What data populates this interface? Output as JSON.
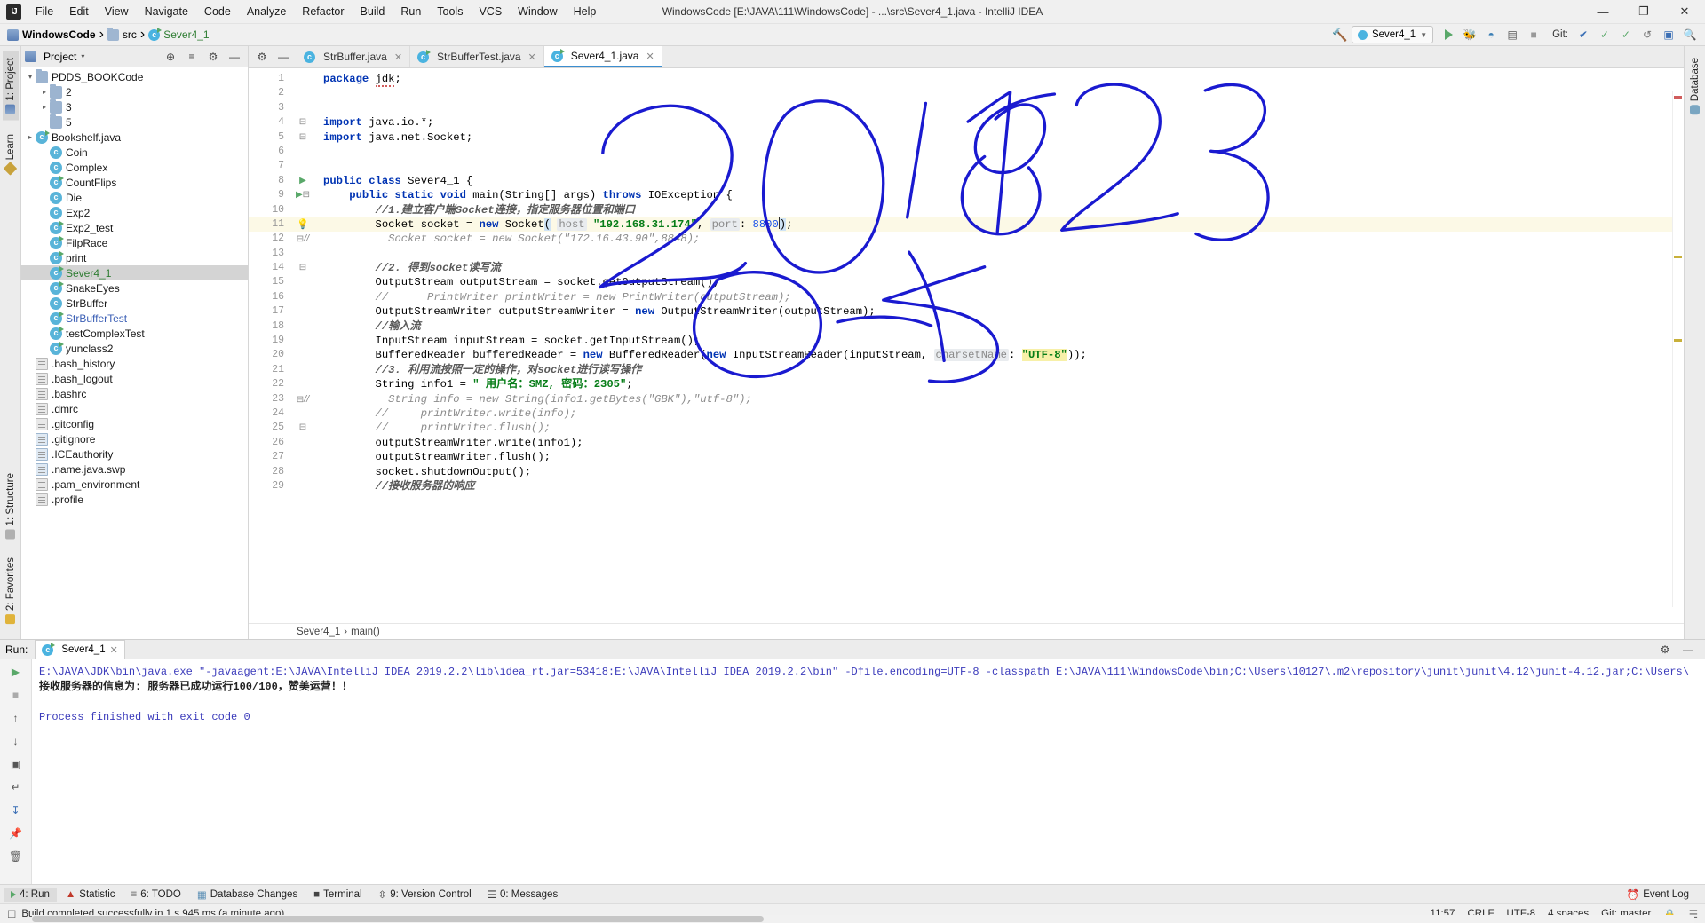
{
  "window": {
    "title": "WindowsCode [E:\\JAVA\\111\\WindowsCode] - ...\\src\\Sever4_1.java - IntelliJ IDEA",
    "logo": "IJ",
    "minimize": "—",
    "maximize": "❐",
    "close": "✕"
  },
  "menubar": {
    "items": [
      {
        "label": "File"
      },
      {
        "label": "Edit"
      },
      {
        "label": "View"
      },
      {
        "label": "Navigate"
      },
      {
        "label": "Code"
      },
      {
        "label": "Analyze"
      },
      {
        "label": "Refactor"
      },
      {
        "label": "Build"
      },
      {
        "label": "Run"
      },
      {
        "label": "Tools"
      },
      {
        "label": "VCS"
      },
      {
        "label": "Window"
      },
      {
        "label": "Help"
      }
    ]
  },
  "navbar": {
    "crumbs": [
      {
        "label": "WindowsCode",
        "icon": "project-icon"
      },
      {
        "label": "src",
        "icon": "folder-icon"
      },
      {
        "label": "Sever4_1",
        "icon": "java-class-icon"
      }
    ],
    "separator": "›",
    "run_config": "Sever4_1",
    "git_label": "Git:",
    "actions": {
      "hammer": "⚒",
      "run": "run-icon",
      "debug": "ὁE",
      "coverage": "◑",
      "profile": "▤",
      "stop": "■",
      "update": "✔",
      "commit": "✓",
      "push": "↑",
      "rollback": "↺",
      "layout": "▣",
      "search": "ὐD"
    }
  },
  "left_strip": {
    "tabs": [
      {
        "label": "1: Project",
        "icon": "project-icon",
        "active": true
      },
      {
        "label": "Learn",
        "icon": "learn-icon",
        "active": false
      }
    ],
    "bottom_tabs": [
      {
        "label": "1: Structure",
        "icon": "structure-icon"
      },
      {
        "label": "2: Favorites",
        "icon": "favorites-icon"
      }
    ]
  },
  "right_strip": {
    "tabs": [
      {
        "label": "Database",
        "icon": "database-icon"
      }
    ]
  },
  "project_panel": {
    "title": "Project",
    "caret": "▾",
    "actions": [
      {
        "name": "locate-icon",
        "glyph": "⊕"
      },
      {
        "name": "collapse-all-icon",
        "glyph": "≡"
      },
      {
        "name": "settings-icon",
        "glyph": "⚙"
      },
      {
        "name": "hide-icon",
        "glyph": "—"
      }
    ],
    "tree": [
      {
        "label": "PDDS_BOOKCode",
        "icon": "folder-icon",
        "arrow": "∨",
        "indent": 1,
        "color": "normal"
      },
      {
        "label": "2",
        "icon": "folder-icon",
        "arrow": "›",
        "indent": 2,
        "color": "normal"
      },
      {
        "label": "3",
        "icon": "folder-icon",
        "arrow": "›",
        "indent": 2,
        "color": "normal"
      },
      {
        "label": "5",
        "icon": "folder-icon",
        "arrow": "",
        "indent": 2,
        "color": "normal"
      },
      {
        "label": "Bookshelf.java",
        "icon": "java-class-run-icon",
        "arrow": "›",
        "indent": 1,
        "color": "normal"
      },
      {
        "label": "Coin",
        "icon": "java-class-icon",
        "arrow": "",
        "indent": 2,
        "color": "normal"
      },
      {
        "label": "Complex",
        "icon": "java-class-icon",
        "arrow": "",
        "indent": 2,
        "color": "normal"
      },
      {
        "label": "CountFlips",
        "icon": "java-class-run-icon",
        "arrow": "",
        "indent": 2,
        "color": "normal"
      },
      {
        "label": "Die",
        "icon": "java-class-icon",
        "arrow": "",
        "indent": 2,
        "color": "normal"
      },
      {
        "label": "Exp2",
        "icon": "java-class-icon",
        "arrow": "",
        "indent": 2,
        "color": "normal"
      },
      {
        "label": "Exp2_test",
        "icon": "java-class-run-icon",
        "arrow": "",
        "indent": 2,
        "color": "normal"
      },
      {
        "label": "FilpRace",
        "icon": "java-class-run-icon",
        "arrow": "",
        "indent": 2,
        "color": "normal"
      },
      {
        "label": "print",
        "icon": "java-class-run-icon",
        "arrow": "",
        "indent": 2,
        "color": "normal"
      },
      {
        "label": "Sever4_1",
        "icon": "java-class-run-icon",
        "arrow": "",
        "indent": 2,
        "color": "green",
        "selected": true
      },
      {
        "label": "SnakeEyes",
        "icon": "java-class-run-icon",
        "arrow": "",
        "indent": 2,
        "color": "normal"
      },
      {
        "label": "StrBuffer",
        "icon": "java-class-icon",
        "arrow": "",
        "indent": 2,
        "color": "normal"
      },
      {
        "label": "StrBufferTest",
        "icon": "java-class-run-icon",
        "arrow": "",
        "indent": 2,
        "color": "blue"
      },
      {
        "label": "testComplexTest",
        "icon": "java-class-run-icon",
        "arrow": "",
        "indent": 2,
        "color": "normal"
      },
      {
        "label": "yunclass2",
        "icon": "java-class-run-icon",
        "arrow": "",
        "indent": 2,
        "color": "normal"
      },
      {
        "label": ".bash_history",
        "icon": "file-icon",
        "arrow": "",
        "indent": 1,
        "color": "normal"
      },
      {
        "label": ".bash_logout",
        "icon": "file-icon",
        "arrow": "",
        "indent": 1,
        "color": "normal"
      },
      {
        "label": ".bashrc",
        "icon": "file-icon",
        "arrow": "",
        "indent": 1,
        "color": "normal"
      },
      {
        "label": ".dmrc",
        "icon": "file-icon",
        "arrow": "",
        "indent": 1,
        "color": "normal"
      },
      {
        "label": ".gitconfig",
        "icon": "file-icon",
        "arrow": "",
        "indent": 1,
        "color": "normal"
      },
      {
        "label": ".gitignore",
        "icon": "config-file-icon",
        "arrow": "",
        "indent": 1,
        "color": "normal"
      },
      {
        "label": ".ICEauthority",
        "icon": "config-file-icon",
        "arrow": "",
        "indent": 1,
        "color": "normal"
      },
      {
        "label": ".name.java.swp",
        "icon": "config-file-icon",
        "arrow": "",
        "indent": 1,
        "color": "normal"
      },
      {
        "label": ".pam_environment",
        "icon": "file-icon",
        "arrow": "",
        "indent": 1,
        "color": "normal"
      },
      {
        "label": ".profile",
        "icon": "file-icon",
        "arrow": "",
        "indent": 1,
        "color": "normal"
      }
    ]
  },
  "editor": {
    "tabs": [
      {
        "label": "StrBuffer.java",
        "icon": "java-class-icon",
        "active": false,
        "close": "✕"
      },
      {
        "label": "StrBufferTest.java",
        "icon": "java-class-run-icon",
        "active": false,
        "close": "✕"
      },
      {
        "label": "Sever4_1.java",
        "icon": "java-class-run-icon",
        "active": true,
        "close": "✕"
      }
    ],
    "tab_actions": [
      {
        "name": "settings-icon",
        "glyph": "⚙"
      },
      {
        "name": "hide-icon",
        "glyph": "—"
      }
    ],
    "breadcrumbs": [
      "Sever4_1",
      "main()"
    ],
    "breadcrumb_sep": "›",
    "first_line": 1,
    "lines": [
      {
        "n": 1,
        "marker": "",
        "html": "<span class=\"kw\">package</span> <span class=\"squig\">jdk</span>;"
      },
      {
        "n": 2,
        "marker": "",
        "html": ""
      },
      {
        "n": 3,
        "marker": "",
        "html": ""
      },
      {
        "n": 4,
        "marker": "fold",
        "html": "<span class=\"kw\">import</span> java.io.*;"
      },
      {
        "n": 5,
        "marker": "fold",
        "html": "<span class=\"kw\">import</span> java.net.Socket;"
      },
      {
        "n": 6,
        "marker": "",
        "html": ""
      },
      {
        "n": 7,
        "marker": "",
        "html": ""
      },
      {
        "n": 8,
        "marker": "run",
        "html": "<span class=\"kw\">public class</span> Sever4_1 {"
      },
      {
        "n": 9,
        "marker": "run-fold",
        "html": "    <span class=\"kw\">public static void</span> main(String[] args) <span class=\"kw\">throws</span> IOException {"
      },
      {
        "n": 10,
        "marker": "",
        "html": "        <span class=\"cmt-b\">//1.建立客户端Socket连接，指定服务器位置和端口</span>"
      },
      {
        "n": 11,
        "marker": "bulb",
        "highlight": true,
        "html": "        Socket socket = <span class=\"kw\">new</span> Socket<span class=\"sel-paren\">(</span> <span class=\"hint\">host</span> <span class=\"str\">\"192.168.31.174\"</span>, <span class=\"hint\">port</span>: <span class=\"num\">8800</span><span class=\"caret-i\"></span><span class=\"sel-paren\">)</span>;"
      },
      {
        "n": 12,
        "marker": "fold-cmt",
        "html": "          <span class=\"cmt\">Socket socket = new Socket(\"172.16.43.90\",8848);</span>"
      },
      {
        "n": 13,
        "marker": "",
        "html": ""
      },
      {
        "n": 14,
        "marker": "fold",
        "html": "        <span class=\"cmt-b\">//2. 得到socket读写流</span>"
      },
      {
        "n": 15,
        "marker": "",
        "html": "        OutputStream outputStream = socket.getOutputStream();"
      },
      {
        "n": 16,
        "marker": "",
        "html": "        <span class=\"cmt\">//      PrintWriter printWriter = new PrintWriter(outputStream);</span>"
      },
      {
        "n": 17,
        "marker": "",
        "html": "        OutputStreamWriter outputStreamWriter = <span class=\"kw\">new</span> OutputStreamWriter(outputStream);"
      },
      {
        "n": 18,
        "marker": "",
        "html": "        <span class=\"cmt-b\">//输入流</span>"
      },
      {
        "n": 19,
        "marker": "",
        "html": "        InputStream inputStream = socket.getInputStream();"
      },
      {
        "n": 20,
        "marker": "",
        "html": "        BufferedReader bufferedReader = <span class=\"kw\">new</span> BufferedReader(<span class=\"kw\">new</span> InputStreamReader(inputStream, <span class=\"hint\">charsetName</span>: <span class=\"str hl-utf\">\"UTF-8\"</span>));"
      },
      {
        "n": 21,
        "marker": "",
        "html": "        <span class=\"cmt-b\">//3. 利用流按照一定的操作，对socket进行读写操作</span>"
      },
      {
        "n": 22,
        "marker": "",
        "html": "        String info1 = <span class=\"str\">\" 用户名：SMZ, 密码：2305\"</span>;"
      },
      {
        "n": 23,
        "marker": "fold-cmt",
        "html": "          <span class=\"cmt\">String info = new String(info1.getBytes(\"GBK\"),\"utf-8\");</span>"
      },
      {
        "n": 24,
        "marker": "",
        "html": "        <span class=\"cmt\">//     printWriter.write(info);</span>"
      },
      {
        "n": 25,
        "marker": "fold",
        "html": "        <span class=\"cmt\">//     printWriter.flush();</span>"
      },
      {
        "n": 26,
        "marker": "",
        "html": "        outputStreamWriter.write(info1);"
      },
      {
        "n": 27,
        "marker": "",
        "html": "        outputStreamWriter.flush();"
      },
      {
        "n": 28,
        "marker": "",
        "html": "        socket.shutdownOutput();"
      },
      {
        "n": 29,
        "marker": "",
        "html": "        <span class=\"cmt-b\">//接收服务器的响应</span>"
      }
    ]
  },
  "run_panel": {
    "title": "Run:",
    "tab_label": "Sever4_1",
    "tab_close": "✕",
    "tab_icon": "run-config-icon",
    "tools": [
      {
        "name": "rerun-icon",
        "glyph": "▶"
      },
      {
        "name": "stop-icon",
        "glyph": "■"
      },
      {
        "name": "up-stack-icon",
        "glyph": "↑"
      },
      {
        "name": "down-stack-icon",
        "glyph": "↓"
      },
      {
        "name": "camera-icon",
        "glyph": "▣"
      },
      {
        "name": "print-icon",
        "glyph": "⎙"
      },
      {
        "name": "wrap-icon",
        "glyph": "↵"
      },
      {
        "name": "scroll-end-icon",
        "glyph": "↧"
      },
      {
        "name": "pin-icon",
        "glyph": "✒"
      },
      {
        "name": "trash-icon",
        "glyph": "Ὕ1"
      }
    ],
    "head_actions": [
      {
        "name": "settings-icon",
        "glyph": "⚙"
      },
      {
        "name": "hide-icon",
        "glyph": "—"
      }
    ],
    "console": [
      {
        "cls": "c-cmd",
        "text": "E:\\JAVA\\JDK\\bin\\java.exe \"-javaagent:E:\\JAVA\\IntelliJ IDEA 2019.2.2\\lib\\idea_rt.jar=53418:E:\\JAVA\\IntelliJ IDEA 2019.2.2\\bin\" -Dfile.encoding=UTF-8 -classpath E:\\JAVA\\111\\WindowsCode\\bin;C:\\Users\\10127\\.m2\\repository\\junit\\junit\\4.12\\junit-4.12.jar;C:\\Users\\"
      },
      {
        "cls": "c-out",
        "text": "接收服务器的信息为: 服务器已成功运行100/100，赞美运营！！"
      },
      {
        "cls": "",
        "text": ""
      },
      {
        "cls": "c-fin",
        "text": "Process finished with exit code 0"
      }
    ]
  },
  "bottombar": {
    "items": [
      {
        "label": "4: Run",
        "icon": "run-icon",
        "active": true
      },
      {
        "label": "Statistic",
        "icon": "statistic-icon",
        "active": false
      },
      {
        "label": "6: TODO",
        "icon": "todo-icon",
        "active": false
      },
      {
        "label": "Database Changes",
        "icon": "database-changes-icon",
        "active": false
      },
      {
        "label": "Terminal",
        "icon": "terminal-icon",
        "active": false
      },
      {
        "label": "9: Version Control",
        "icon": "version-control-icon",
        "active": false
      },
      {
        "label": "0: Messages",
        "icon": "messages-icon",
        "active": false
      }
    ],
    "right": {
      "label": "Event Log",
      "icon": "event-log-icon"
    }
  },
  "statusbar": {
    "message": "Build completed successfully in 1 s 945 ms (a minute ago)",
    "time": "11:57",
    "line_sep": "CRLF",
    "encoding": "UTF-8",
    "indent": "4 spaces",
    "branch": "Git: master",
    "icons": [
      {
        "name": "lock-icon",
        "glyph": "ὑ2"
      },
      {
        "name": "inspection-icon",
        "glyph": "☰"
      }
    ]
  },
  "colors": {
    "accent": "#3b8ed0",
    "run_green": "#59a869",
    "string_green": "#067d17",
    "keyword_blue": "#0033b3",
    "ink_blue": "#1a1ad0",
    "highlight_line": "#fcf9e6"
  }
}
